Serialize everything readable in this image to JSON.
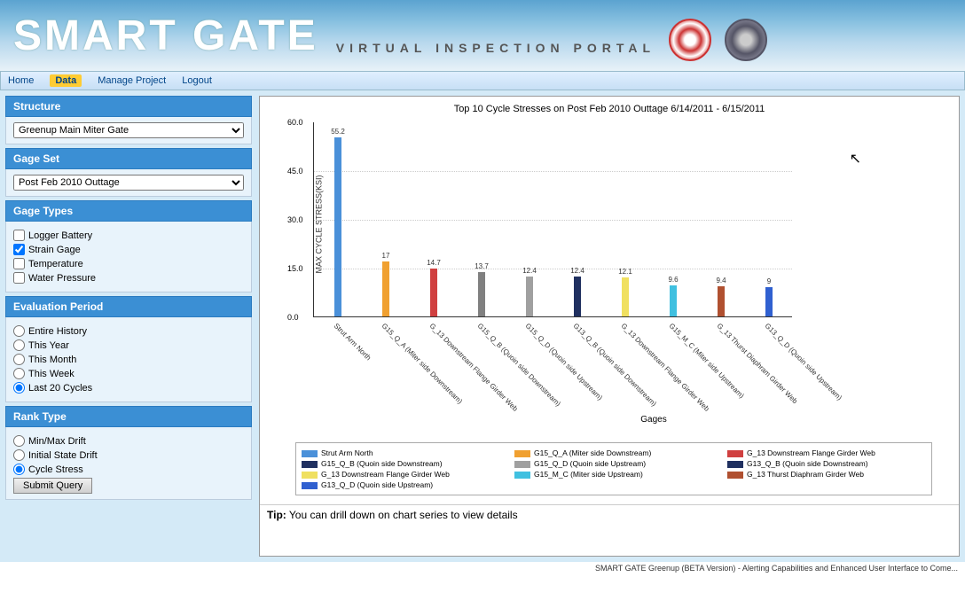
{
  "header": {
    "title": "SMART GATE",
    "subtitle": "VIRTUAL INSPECTION PORTAL"
  },
  "nav": {
    "items": [
      "Home",
      "Data",
      "Manage Project",
      "Logout"
    ],
    "active_index": 1
  },
  "sidebar": {
    "structure": {
      "header": "Structure",
      "selected": "Greenup Main Miter Gate"
    },
    "gage_set": {
      "header": "Gage Set",
      "selected": "Post Feb 2010 Outtage"
    },
    "gage_types": {
      "header": "Gage Types",
      "options": [
        {
          "label": "Logger Battery",
          "checked": false
        },
        {
          "label": "Strain Gage",
          "checked": true
        },
        {
          "label": "Temperature",
          "checked": false
        },
        {
          "label": "Water Pressure",
          "checked": false
        }
      ]
    },
    "evaluation_period": {
      "header": "Evaluation Period",
      "options": [
        {
          "label": "Entire History",
          "checked": false
        },
        {
          "label": "This Year",
          "checked": false
        },
        {
          "label": "This Month",
          "checked": false
        },
        {
          "label": "This Week",
          "checked": false
        },
        {
          "label": "Last 20 Cycles",
          "checked": true
        }
      ]
    },
    "rank_type": {
      "header": "Rank Type",
      "options": [
        {
          "label": "Min/Max Drift",
          "checked": false
        },
        {
          "label": "Initial State Drift",
          "checked": false
        },
        {
          "label": "Cycle Stress",
          "checked": true
        }
      ]
    },
    "submit_label": "Submit Query"
  },
  "chart_data": {
    "type": "bar",
    "title": "Top 10 Cycle Stresses on Post Feb 2010 Outtage 6/14/2011 - 6/15/2011",
    "ylabel": "MAX CYCLE STRESS(KSI)",
    "xlabel": "Gages",
    "ylim": [
      0,
      60
    ],
    "y_ticks": [
      0.0,
      15.0,
      30.0,
      45.0,
      60.0
    ],
    "categories": [
      "Strut Arm North",
      "G15_Q_A (Miter side Downstream)",
      "G_13 Downstream Flange Girder Web",
      "G15_Q_B (Quoin side Downstream)",
      "G15_Q_D (Quoin side Upstream)",
      "G13_Q_B (Quoin side Downstream)",
      "G_13 Downstream Flange Girder Web",
      "G15_M_C (Miter side Upstream)",
      "G_13 Thurst Diaphram Girder Web",
      "G13_Q_D (Quoin side Upstream)"
    ],
    "values": [
      55.2,
      17,
      14.7,
      13.7,
      12.4,
      12.4,
      12.1,
      9.6,
      9.4,
      9
    ],
    "colors": [
      "#4a90d9",
      "#f0a030",
      "#d04040",
      "#808080",
      "#a0a0a0",
      "#203060",
      "#f0e060",
      "#40c0e0",
      "#b05030",
      "#3060d0"
    ],
    "legend": [
      {
        "color": "#4a90d9",
        "label": "Strut Arm North"
      },
      {
        "color": "#f0a030",
        "label": "G15_Q_A (Miter side Downstream)"
      },
      {
        "color": "#d04040",
        "label": "G_13 Downstream Flange Girder Web"
      },
      {
        "color": "#203060",
        "label": "G15_Q_B (Quoin side Downstream)"
      },
      {
        "color": "#a0a0a0",
        "label": "G15_Q_D (Quoin side Upstream)"
      },
      {
        "color": "#203060",
        "label": "G13_Q_B (Quoin side Downstream)"
      },
      {
        "color": "#f0e060",
        "label": "G_13 Downstream Flange Girder Web"
      },
      {
        "color": "#40c0e0",
        "label": "G15_M_C (Miter side Upstream)"
      },
      {
        "color": "#b05030",
        "label": "G_13 Thurst Diaphram Girder Web"
      },
      {
        "color": "#3060d0",
        "label": "G13_Q_D (Quoin side Upstream)"
      }
    ]
  },
  "tip": {
    "label": "Tip:",
    "text": "You can drill down on chart series to view details"
  },
  "footer": "SMART GATE Greenup (BETA Version) - Alerting Capabilities and Enhanced User Interface to Come..."
}
